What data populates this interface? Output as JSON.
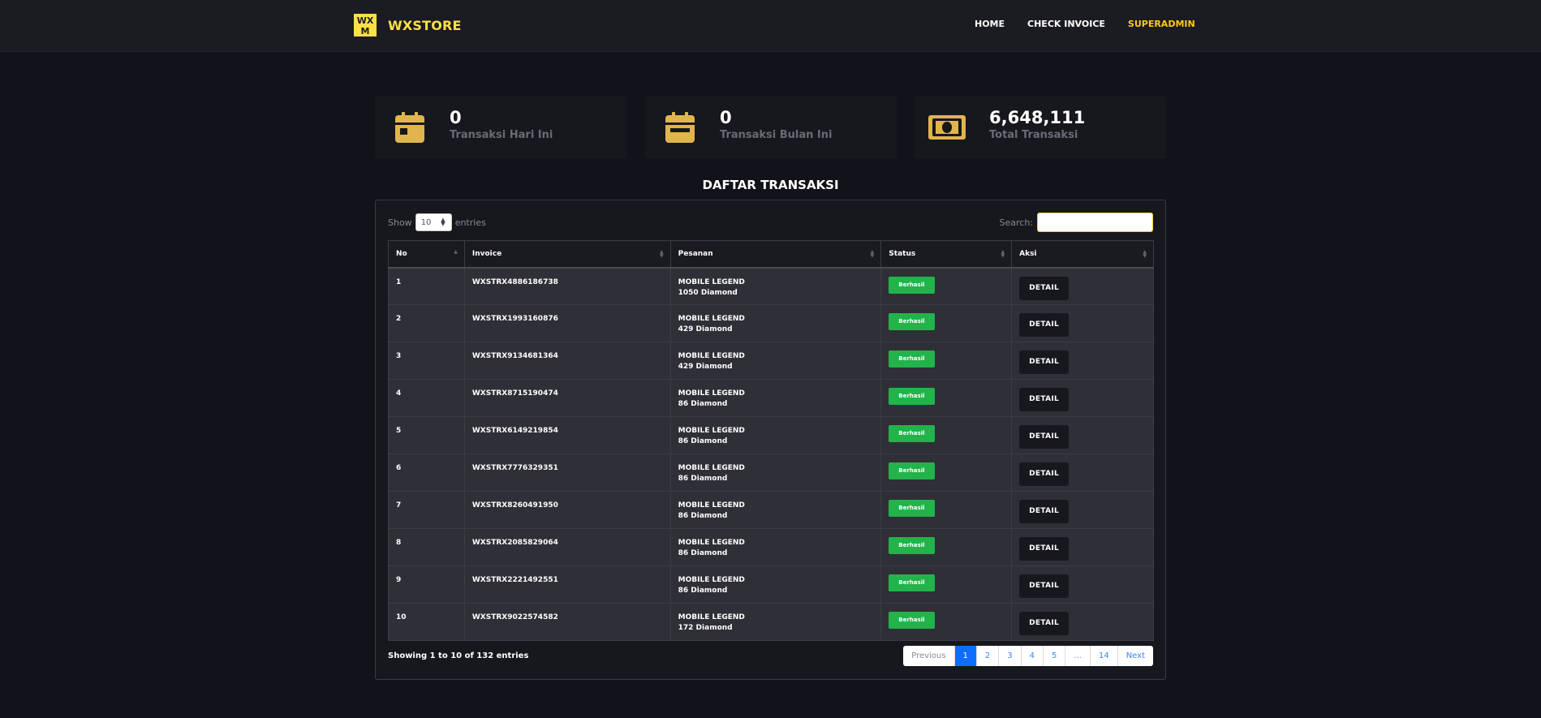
{
  "brand": {
    "name": "WXSTORE",
    "logo_text": "WXM"
  },
  "nav": [
    {
      "label": "HOME"
    },
    {
      "label": "CHECK INVOICE"
    },
    {
      "label": "SUPERADMIN"
    }
  ],
  "stats": [
    {
      "value": "0",
      "label": "Transaksi Hari Ini",
      "icon": "calendar-day-icon"
    },
    {
      "value": "0",
      "label": "Transaksi Bulan Ini",
      "icon": "calendar-month-icon"
    },
    {
      "value": "6,648,111",
      "label": "Total Transaksi",
      "icon": "money-bill-icon"
    }
  ],
  "section_title": "DAFTAR TRANSAKSI",
  "table_controls": {
    "show_label": "Show",
    "entries_value": "10",
    "entries_label": "entries",
    "search_label": "Search:",
    "search_value": ""
  },
  "table": {
    "headers": [
      "No",
      "Invoice",
      "Pesanan",
      "Status",
      "Aksi"
    ],
    "rows": [
      {
        "no": "1",
        "invoice": "WXSTRX4886186738",
        "game": "MOBILE LEGEND",
        "item": "1050 Diamond",
        "status": "Berhasil",
        "action": "DETAIL"
      },
      {
        "no": "2",
        "invoice": "WXSTRX1993160876",
        "game": "MOBILE LEGEND",
        "item": "429 Diamond",
        "status": "Berhasil",
        "action": "DETAIL"
      },
      {
        "no": "3",
        "invoice": "WXSTRX9134681364",
        "game": "MOBILE LEGEND",
        "item": "429 Diamond",
        "status": "Berhasil",
        "action": "DETAIL"
      },
      {
        "no": "4",
        "invoice": "WXSTRX8715190474",
        "game": "MOBILE LEGEND",
        "item": "86 Diamond",
        "status": "Berhasil",
        "action": "DETAIL"
      },
      {
        "no": "5",
        "invoice": "WXSTRX6149219854",
        "game": "MOBILE LEGEND",
        "item": "86 Diamond",
        "status": "Berhasil",
        "action": "DETAIL"
      },
      {
        "no": "6",
        "invoice": "WXSTRX7776329351",
        "game": "MOBILE LEGEND",
        "item": "86 Diamond",
        "status": "Berhasil",
        "action": "DETAIL"
      },
      {
        "no": "7",
        "invoice": "WXSTRX8260491950",
        "game": "MOBILE LEGEND",
        "item": "86 Diamond",
        "status": "Berhasil",
        "action": "DETAIL"
      },
      {
        "no": "8",
        "invoice": "WXSTRX2085829064",
        "game": "MOBILE LEGEND",
        "item": "86 Diamond",
        "status": "Berhasil",
        "action": "DETAIL"
      },
      {
        "no": "9",
        "invoice": "WXSTRX2221492551",
        "game": "MOBILE LEGEND",
        "item": "86 Diamond",
        "status": "Berhasil",
        "action": "DETAIL"
      },
      {
        "no": "10",
        "invoice": "WXSTRX9022574582",
        "game": "MOBILE LEGEND",
        "item": "172 Diamond",
        "status": "Berhasil",
        "action": "DETAIL"
      }
    ]
  },
  "footer": {
    "info": "Showing 1 to 10 of 132 entries",
    "pagination": [
      "Previous",
      "1",
      "2",
      "3",
      "4",
      "5",
      "...",
      "14",
      "Next"
    ],
    "active_page": "1"
  },
  "colors": {
    "accent": "#fde047",
    "icon_gold": "#e0b54e",
    "success": "#22b34a",
    "page_active": "#0d6efd"
  }
}
